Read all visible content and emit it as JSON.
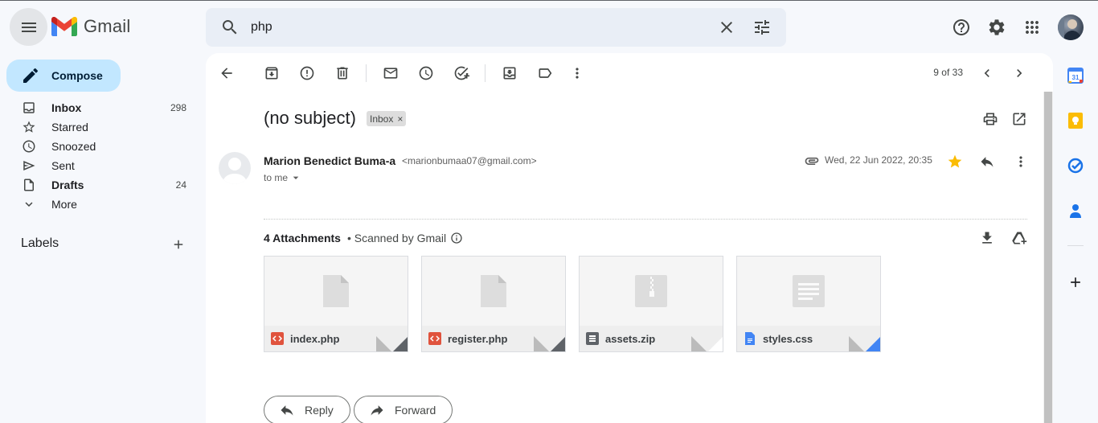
{
  "app": {
    "name": "Gmail"
  },
  "search": {
    "value": "php"
  },
  "sidebar": {
    "compose_label": "Compose",
    "items": [
      {
        "label": "Inbox",
        "count": "298",
        "bold": true,
        "icon": "inbox-icon"
      },
      {
        "label": "Starred",
        "count": "",
        "bold": false,
        "icon": "star-outline-icon"
      },
      {
        "label": "Snoozed",
        "count": "",
        "bold": false,
        "icon": "clock-icon"
      },
      {
        "label": "Sent",
        "count": "",
        "bold": false,
        "icon": "send-icon"
      },
      {
        "label": "Drafts",
        "count": "24",
        "bold": true,
        "icon": "draft-icon"
      },
      {
        "label": "More",
        "count": "",
        "bold": false,
        "icon": "chevron-down-icon"
      }
    ],
    "labels_heading": "Labels"
  },
  "toolbar": {
    "page_count": "9 of 33"
  },
  "email": {
    "subject": "(no subject)",
    "label_chip": "Inbox",
    "label_chip_close": "×",
    "sender_name": "Marion Benedict Buma-a",
    "sender_email": "<marionbumaa07@gmail.com>",
    "to": "to me",
    "date": "Wed, 22 Jun 2022, 20:35",
    "starred": true,
    "attachments_count": "4 Attachments",
    "attachments_scan": "• Scanned by Gmail",
    "attachments": [
      {
        "name": "index.php",
        "type": "code",
        "icon_color": "#e0533d",
        "fold_color": "#5f6368"
      },
      {
        "name": "register.php",
        "type": "code",
        "icon_color": "#e0533d",
        "fold_color": "#5f6368"
      },
      {
        "name": "assets.zip",
        "type": "zip",
        "icon_color": "#5f6368",
        "fold_color": "#ffffff"
      },
      {
        "name": "styles.css",
        "type": "doc",
        "icon_color": "#4285f4",
        "fold_color": "#4285f4"
      }
    ],
    "reply_label": "Reply",
    "forward_label": "Forward"
  },
  "colors": {
    "accent": "#c2e7ff",
    "star": "#fbbc04",
    "search_bg": "#e9eef6"
  }
}
